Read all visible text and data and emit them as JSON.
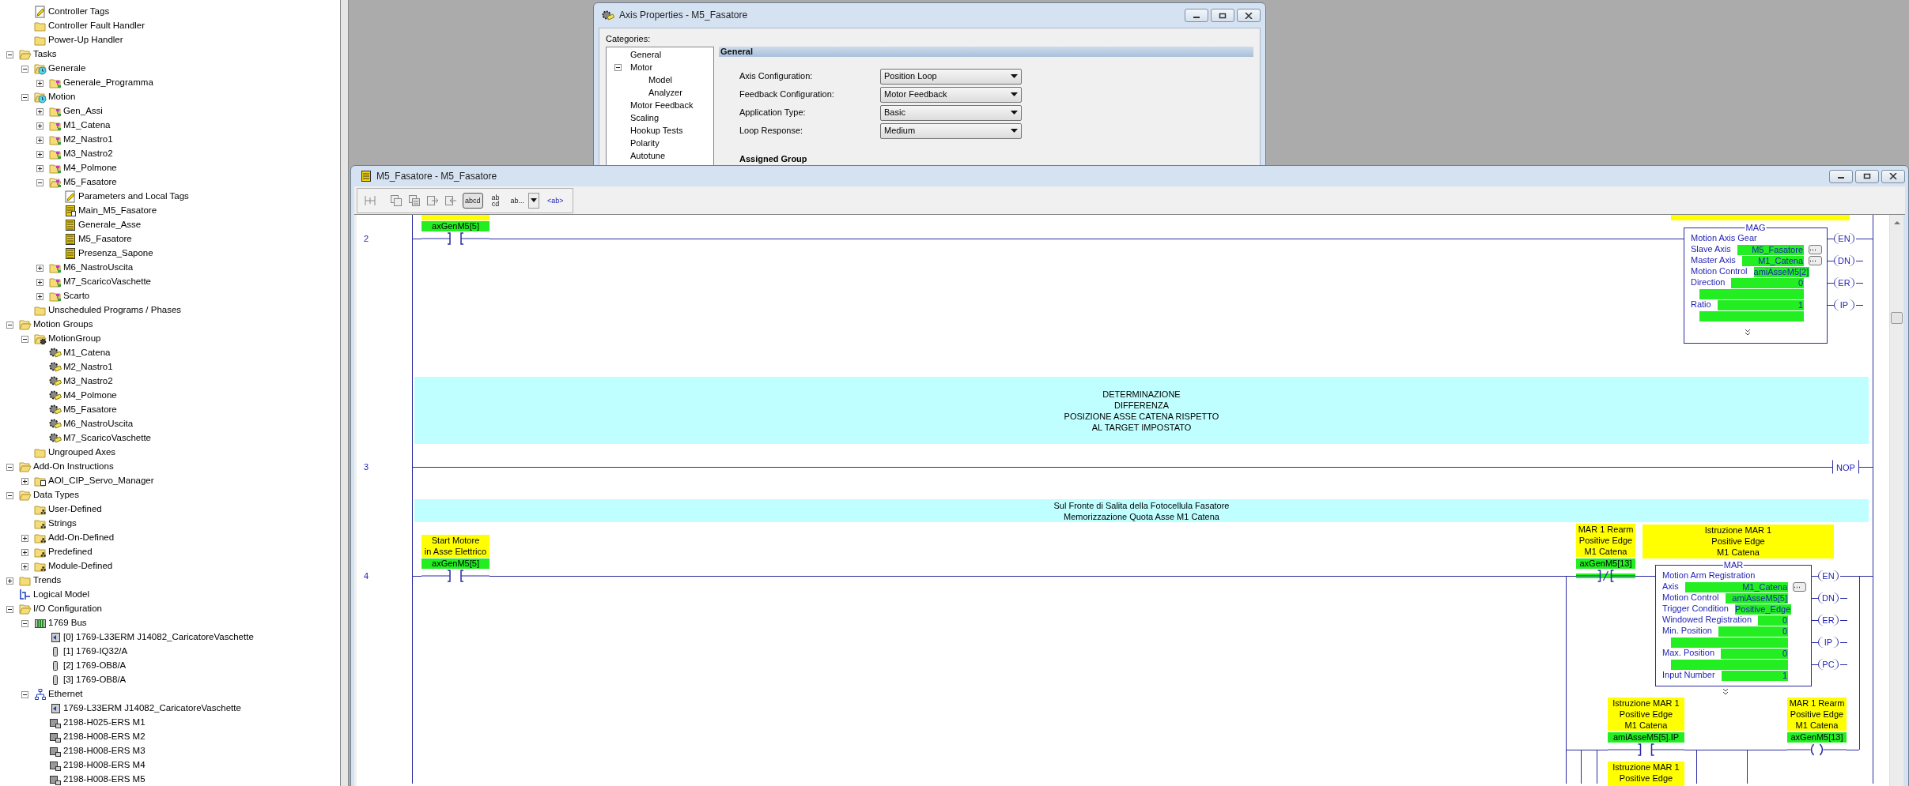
{
  "tree": {
    "controller_children": [
      {
        "label": "Controller Tags",
        "kind": "tags"
      },
      {
        "label": "Controller Fault Handler",
        "kind": "folder"
      },
      {
        "label": "Power-Up Handler",
        "kind": "folder"
      }
    ],
    "items": [
      {
        "label": "Tasks",
        "kind": "folder",
        "expanded": true,
        "children": [
          {
            "label": "Generale",
            "kind": "task",
            "expanded": true,
            "children": [
              {
                "label": "Generale_Programma",
                "kind": "program",
                "expanded": false
              }
            ]
          },
          {
            "label": "Motion",
            "kind": "task",
            "expanded": true,
            "children": [
              {
                "label": "Gen_Assi",
                "kind": "program",
                "expanded": false
              },
              {
                "label": "M1_Catena",
                "kind": "program",
                "expanded": false
              },
              {
                "label": "M2_Nastro1",
                "kind": "program",
                "expanded": false
              },
              {
                "label": "M3_Nastro2",
                "kind": "program",
                "expanded": false
              },
              {
                "label": "M4_Polmone",
                "kind": "program",
                "expanded": false
              },
              {
                "label": "M5_Fasatore",
                "kind": "program",
                "expanded": true,
                "children": [
                  {
                    "label": "Parameters and Local Tags",
                    "kind": "tags"
                  },
                  {
                    "label": "Main_M5_Fasatore",
                    "kind": "main-routine"
                  },
                  {
                    "label": "Generale_Asse",
                    "kind": "routine"
                  },
                  {
                    "label": "M5_Fasatore",
                    "kind": "routine"
                  },
                  {
                    "label": "Presenza_Sapone",
                    "kind": "routine"
                  }
                ]
              },
              {
                "label": "M6_NastroUscita",
                "kind": "program",
                "expanded": false
              },
              {
                "label": "M7_ScaricoVaschette",
                "kind": "program",
                "expanded": false
              },
              {
                "label": "Scarto",
                "kind": "program",
                "expanded": false
              }
            ]
          },
          {
            "label": "Unscheduled Programs / Phases",
            "kind": "folder"
          }
        ]
      },
      {
        "label": "Motion Groups",
        "kind": "folder",
        "expanded": true,
        "children": [
          {
            "label": "MotionGroup",
            "kind": "motion-group",
            "expanded": true,
            "children": [
              {
                "label": "M1_Catena",
                "kind": "axis"
              },
              {
                "label": "M2_Nastro1",
                "kind": "axis"
              },
              {
                "label": "M3_Nastro2",
                "kind": "axis"
              },
              {
                "label": "M4_Polmone",
                "kind": "axis"
              },
              {
                "label": "M5_Fasatore",
                "kind": "axis"
              },
              {
                "label": "M6_NastroUscita",
                "kind": "axis"
              },
              {
                "label": "M7_ScaricoVaschette",
                "kind": "axis"
              }
            ]
          },
          {
            "label": "Ungrouped Axes",
            "kind": "folder"
          }
        ]
      },
      {
        "label": "Add-On Instructions",
        "kind": "folder",
        "expanded": true,
        "children": [
          {
            "label": "AOI_CIP_Servo_Manager",
            "kind": "aoi",
            "expanded": false
          }
        ]
      },
      {
        "label": "Data Types",
        "kind": "folder",
        "expanded": true,
        "children": [
          {
            "label": "User-Defined",
            "kind": "datatype"
          },
          {
            "label": "Strings",
            "kind": "datatype"
          },
          {
            "label": "Add-On-Defined",
            "kind": "datatype",
            "expanded": false
          },
          {
            "label": "Predefined",
            "kind": "datatype",
            "expanded": false
          },
          {
            "label": "Module-Defined",
            "kind": "datatype",
            "expanded": false
          }
        ]
      },
      {
        "label": "Trends",
        "kind": "folder",
        "expanded": false
      },
      {
        "label": "Logical Model",
        "kind": "logical"
      },
      {
        "label": "I/O Configuration",
        "kind": "folder",
        "expanded": true,
        "children": [
          {
            "label": "1769 Bus",
            "kind": "bus",
            "expanded": true,
            "children": [
              {
                "label": "[0] 1769-L33ERM J14082_CaricatoreVaschette",
                "kind": "controller-module"
              },
              {
                "label": "[1] 1769-IQ32/A",
                "kind": "module"
              },
              {
                "label": "[2] 1769-OB8/A",
                "kind": "module"
              },
              {
                "label": "[3] 1769-OB8/A",
                "kind": "module"
              }
            ]
          },
          {
            "label": "Ethernet",
            "kind": "network",
            "expanded": true,
            "children": [
              {
                "label": "1769-L33ERM J14082_CaricatoreVaschette",
                "kind": "controller-module"
              },
              {
                "label": "2198-H025-ERS M1",
                "kind": "drive"
              },
              {
                "label": "2198-H008-ERS M2",
                "kind": "drive"
              },
              {
                "label": "2198-H008-ERS M3",
                "kind": "drive"
              },
              {
                "label": "2198-H008-ERS M4",
                "kind": "drive"
              },
              {
                "label": "2198-H008-ERS M5",
                "kind": "drive"
              }
            ]
          }
        ]
      }
    ]
  },
  "axis_dialog": {
    "title": "Axis Properties - M5_Fasatore",
    "categories_label": "Categories:",
    "categories": [
      {
        "label": "General"
      },
      {
        "label": "Motor",
        "expanded": true,
        "children": [
          {
            "label": "Model"
          },
          {
            "label": "Analyzer"
          }
        ]
      },
      {
        "label": "Motor Feedback"
      },
      {
        "label": "Scaling"
      },
      {
        "label": "Hookup Tests"
      },
      {
        "label": "Polarity"
      },
      {
        "label": "Autotune"
      }
    ],
    "section": "General",
    "fields": [
      {
        "label": "Axis Configuration:",
        "value": "Position Loop"
      },
      {
        "label": "Feedback Configuration:",
        "value": "Motor Feedback"
      },
      {
        "label": "Application Type:",
        "value": "Basic"
      },
      {
        "label": "Loop Response:",
        "value": "Medium"
      }
    ],
    "group_heading": "Assigned Group"
  },
  "ladder_window": {
    "title": "M5_Fasatore - M5_Fasatore",
    "toolbar": [
      {
        "label": "abcd",
        "kind": "toggle",
        "selected": true
      },
      {
        "label": "ab cd",
        "kind": "toggle",
        "selected": false
      },
      {
        "label": "ab...",
        "kind": "dropdown",
        "selected": false
      },
      {
        "label": "<ab>",
        "kind": "toggle",
        "selected": false
      }
    ],
    "rungs": [
      {
        "number": "2",
        "kind": "gear",
        "contact": {
          "tag": "axGenM5[5]",
          "kind": "normally-open",
          "energized": false
        },
        "block": {
          "name": "MAG",
          "description": "Motion Axis Gear",
          "params": [
            {
              "kind": "value",
              "label": "Slave Axis",
              "value": "M5_Fasatore",
              "browse": true
            },
            {
              "kind": "value",
              "label": "Master Axis",
              "value": "M1_Catena",
              "browse": true
            },
            {
              "kind": "value",
              "label": "Motion Control",
              "value": "amiAsseM5[2]",
              "browse": false
            },
            {
              "kind": "value",
              "label": "Direction",
              "value": "0",
              "browse": false
            },
            {
              "kind": "blank"
            },
            {
              "kind": "value",
              "label": "Ratio",
              "value": "1",
              "browse": false
            },
            {
              "kind": "blank"
            }
          ],
          "outputs": [
            "EN",
            "DN",
            "ER",
            "IP"
          ]
        }
      },
      {
        "number": "3",
        "kind": "nop",
        "comment": [
          "DETERMINAZIONE",
          "DIFFERENZA",
          "POSIZIONE ASSE CATENA RISPETTO",
          "AL TARGET IMPOSTATO"
        ],
        "instruction": "NOP"
      },
      {
        "number": "4",
        "kind": "registration",
        "comment": [
          "Sul Fronte di Salita della Fotocellula Fasatore",
          "Memorizzazione Quota Asse M1 Catena"
        ],
        "contact": {
          "description": [
            "Start Motore",
            "in Asse Elettrico"
          ],
          "tag": "axGenM5[5]",
          "kind": "normally-open",
          "energized": false
        },
        "rearm_contact": {
          "description": [
            "MAR 1 Rearm",
            "Positive Edge",
            "M1 Catena"
          ],
          "tag": "axGenM5[13]",
          "kind": "normally-closed",
          "energized": true
        },
        "block_description": [
          "Istruzione MAR 1",
          "Positive Edge",
          "M1 Catena"
        ],
        "block": {
          "name": "MAR",
          "description": "Motion Arm Registration",
          "params": [
            {
              "kind": "value",
              "label": "Axis",
              "value": "M1_Catena",
              "browse": true
            },
            {
              "kind": "value",
              "label": "Motion Control",
              "value": "amiAsseM5[5]",
              "browse": false
            },
            {
              "kind": "value",
              "label": "Trigger Condition",
              "value": "Positive_Edge",
              "browse": false
            },
            {
              "kind": "value",
              "label": "Windowed Registration",
              "value": "0",
              "browse": false
            },
            {
              "kind": "value",
              "label": "Min. Position",
              "value": "0",
              "browse": false
            },
            {
              "kind": "blank"
            },
            {
              "kind": "value",
              "label": "Max. Position",
              "value": "0",
              "browse": false
            },
            {
              "kind": "blank"
            },
            {
              "kind": "value",
              "label": "Input Number",
              "value": "1",
              "browse": false
            }
          ],
          "outputs": [
            "EN",
            "DN",
            "ER",
            "IP",
            "PC"
          ]
        },
        "branch_contact": {
          "description": [
            "Istruzione MAR 1",
            "Positive Edge",
            "M1 Catena"
          ],
          "tag": "amiAsseM5[5].IP",
          "kind": "normally-open",
          "energized": false
        },
        "coil": {
          "description": [
            "MAR 1 Rearm",
            "Positive Edge",
            "M1 Catena"
          ],
          "tag": "axGenM5[13]",
          "energized": false
        },
        "next_description": [
          "Istruzione MAR 1",
          "Positive Edge"
        ]
      }
    ]
  }
}
